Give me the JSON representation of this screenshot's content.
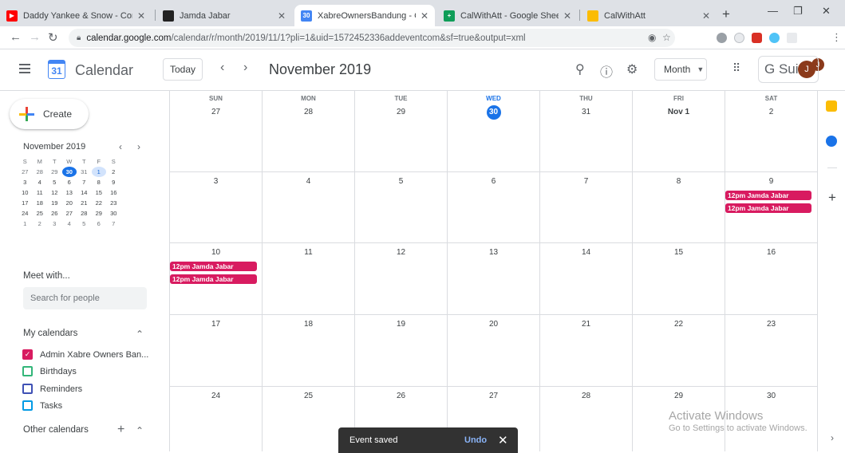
{
  "browser": {
    "tabs": [
      {
        "title": "Daddy Yankee & Snow - Con",
        "favicon_color": "#ff0000"
      },
      {
        "title": "Jamda Jabar",
        "favicon_color": "#222222"
      },
      {
        "title": "XabreOwnersBandung - Calen",
        "favicon_color": "#4285f4",
        "favicon_text": "30",
        "active": true
      },
      {
        "title": "CalWithAtt - Google Sheets",
        "favicon_color": "#0f9d58"
      },
      {
        "title": "CalWithAtt",
        "favicon_color": "#fbbc04"
      }
    ],
    "url_host": "calendar.google.com",
    "url_path": "/calendar/r/month/2019/11/1?pli=1&uid=1572452336addeventcom&sf=true&output=xml",
    "profile_initial": "J"
  },
  "header": {
    "app_title": "Calendar",
    "logo_day": "31",
    "today_label": "Today",
    "month_title": "November 2019",
    "view_label": "Month",
    "suite_label": "G Suite",
    "avatar_initial": "J"
  },
  "sidebar": {
    "create_label": "Create",
    "mini_title": "November 2019",
    "mini_weekdays": [
      "S",
      "M",
      "T",
      "W",
      "T",
      "F",
      "S"
    ],
    "mini_weeks": [
      [
        "27",
        "28",
        "29",
        "30",
        "31",
        "1",
        "2"
      ],
      [
        "3",
        "4",
        "5",
        "6",
        "7",
        "8",
        "9"
      ],
      [
        "10",
        "11",
        "12",
        "13",
        "14",
        "15",
        "16"
      ],
      [
        "17",
        "18",
        "19",
        "20",
        "21",
        "22",
        "23"
      ],
      [
        "24",
        "25",
        "26",
        "27",
        "28",
        "29",
        "30"
      ],
      [
        "1",
        "2",
        "3",
        "4",
        "5",
        "6",
        "7"
      ]
    ],
    "meet_with_label": "Meet with...",
    "search_placeholder": "Search for people",
    "my_calendars_label": "My calendars",
    "my_calendars": [
      {
        "name": "Admin Xabre Owners Ban...",
        "color": "#d81b60",
        "checked": true
      },
      {
        "name": "Birthdays",
        "color": "#33b679",
        "checked": false
      },
      {
        "name": "Reminders",
        "color": "#3f51b5",
        "checked": false
      },
      {
        "name": "Tasks",
        "color": "#039be5",
        "checked": false
      }
    ],
    "other_calendars_label": "Other calendars"
  },
  "grid": {
    "weekdays": [
      "SUN",
      "MON",
      "TUE",
      "WED",
      "THU",
      "FRI",
      "SAT"
    ],
    "weeks": [
      [
        "27",
        "28",
        "29",
        "30",
        "31",
        "Nov 1",
        "2"
      ],
      [
        "3",
        "4",
        "5",
        "6",
        "7",
        "8",
        "9"
      ],
      [
        "10",
        "11",
        "12",
        "13",
        "14",
        "15",
        "16"
      ],
      [
        "17",
        "18",
        "19",
        "20",
        "21",
        "22",
        "23"
      ],
      [
        "24",
        "25",
        "26",
        "27",
        "28",
        "29",
        "30"
      ]
    ],
    "today": "30",
    "event_label": "12pm Jamda Jabar",
    "event_color": "#d81b60"
  },
  "watermark": {
    "title": "Activate Windows",
    "subtitle": "Go to Settings to activate Windows."
  },
  "snackbar": {
    "message": "Event saved",
    "action": "Undo"
  }
}
